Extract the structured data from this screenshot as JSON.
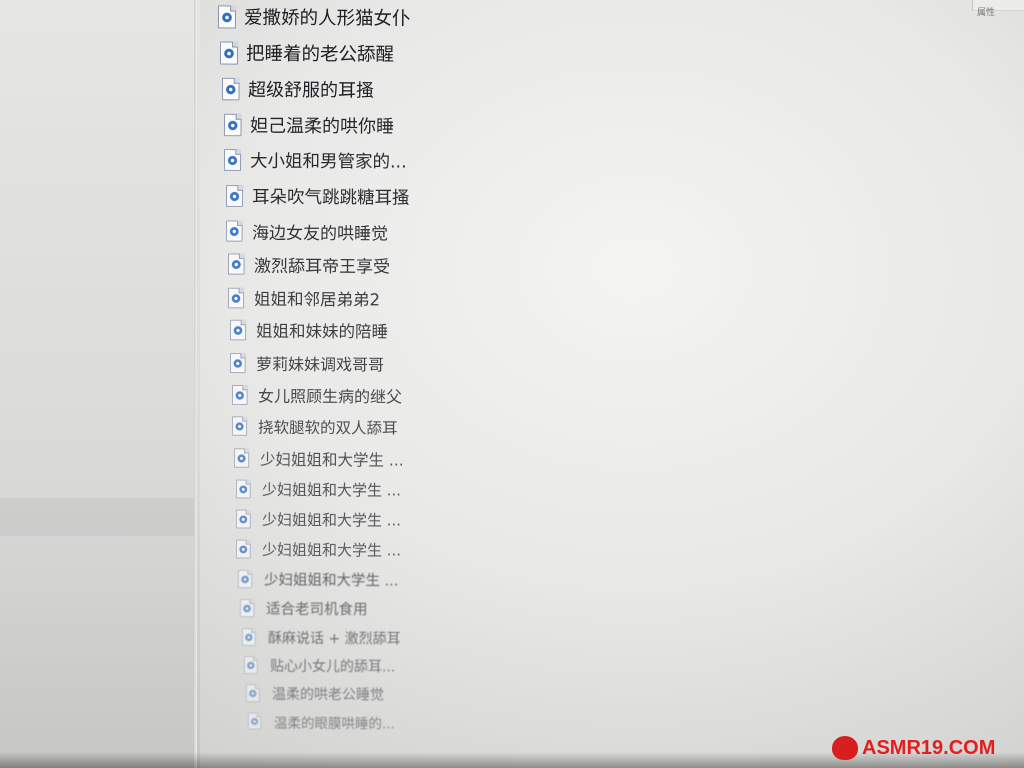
{
  "top_right_fragment": "属性",
  "files": [
    {
      "name": "爱撒娇的人形猫女仆",
      "icon": "audio-file-icon"
    },
    {
      "name": "把睡着的老公舔醒",
      "icon": "audio-file-icon"
    },
    {
      "name": "超级舒服的耳搔",
      "icon": "audio-file-icon"
    },
    {
      "name": "妲己温柔的哄你睡",
      "icon": "audio-file-icon"
    },
    {
      "name": "大小姐和男管家的...",
      "icon": "audio-file-icon"
    },
    {
      "name": "耳朵吹气跳跳糖耳搔",
      "icon": "audio-file-icon"
    },
    {
      "name": "海边女友的哄睡觉",
      "icon": "audio-file-icon"
    },
    {
      "name": "激烈舔耳帝王享受",
      "icon": "audio-file-icon"
    },
    {
      "name": "姐姐和邻居弟弟2",
      "icon": "audio-file-icon"
    },
    {
      "name": "姐姐和妹妹的陪睡",
      "icon": "audio-file-icon"
    },
    {
      "name": "萝莉妹妹调戏哥哥",
      "icon": "audio-file-icon"
    },
    {
      "name": "女儿照顾生病的继父",
      "icon": "audio-file-icon"
    },
    {
      "name": "挠软腿软的双人舔耳",
      "icon": "audio-file-icon"
    },
    {
      "name": "少妇姐姐和大学生 ...",
      "icon": "audio-file-icon"
    },
    {
      "name": "少妇姐姐和大学生 ...",
      "icon": "audio-file-icon"
    },
    {
      "name": "少妇姐姐和大学生 ...",
      "icon": "audio-file-icon"
    },
    {
      "name": "少妇姐姐和大学生 ...",
      "icon": "audio-file-icon"
    },
    {
      "name": "少妇姐姐和大学生 ...",
      "icon": "audio-file-icon"
    },
    {
      "name": "适合老司机食用",
      "icon": "audio-file-icon"
    },
    {
      "name": "酥麻说话 + 激烈舔耳",
      "icon": "audio-file-icon"
    },
    {
      "name": "贴心小女儿的舔耳...",
      "icon": "audio-file-icon"
    },
    {
      "name": "温柔的哄老公睡觉",
      "icon": "audio-file-icon"
    },
    {
      "name": "温柔的眼膜哄睡的...",
      "icon": "audio-file-icon"
    }
  ],
  "watermark": "ASMR19.COM"
}
